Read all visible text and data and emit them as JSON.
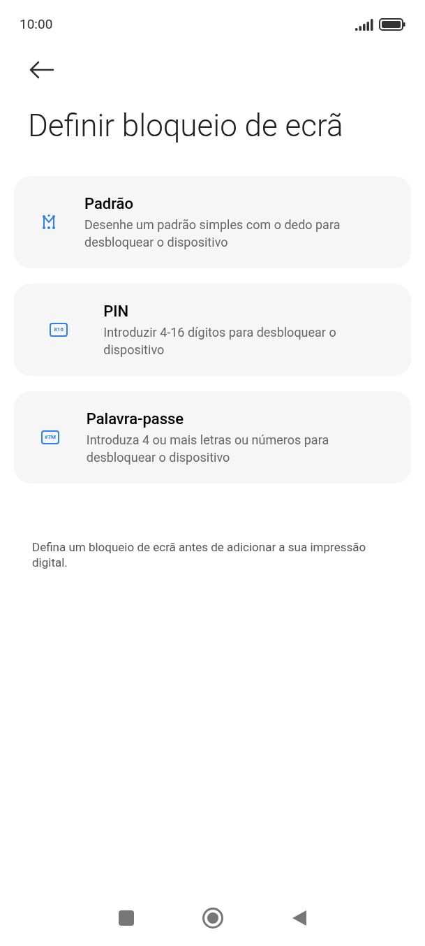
{
  "status_bar": {
    "time": "10:00"
  },
  "title": "Definir bloqueio de ecrã",
  "options": [
    {
      "kind": "pattern",
      "title": "Padrão",
      "description": "Desenhe um padrão simples com o dedo para desbloquear o dispositivo"
    },
    {
      "kind": "pin",
      "icon_text": "816",
      "title": "PIN",
      "description": "Introduzir 4-16 dígitos para desbloquear o dispositivo"
    },
    {
      "kind": "password",
      "icon_text": "#7M",
      "title": "Palavra-passe",
      "description": "Introduza 4 ou mais letras ou números para desbloquear o dispositivo"
    }
  ],
  "footer_note": "Defina um bloqueio de ecrã antes de adicionar a sua impressão digital."
}
